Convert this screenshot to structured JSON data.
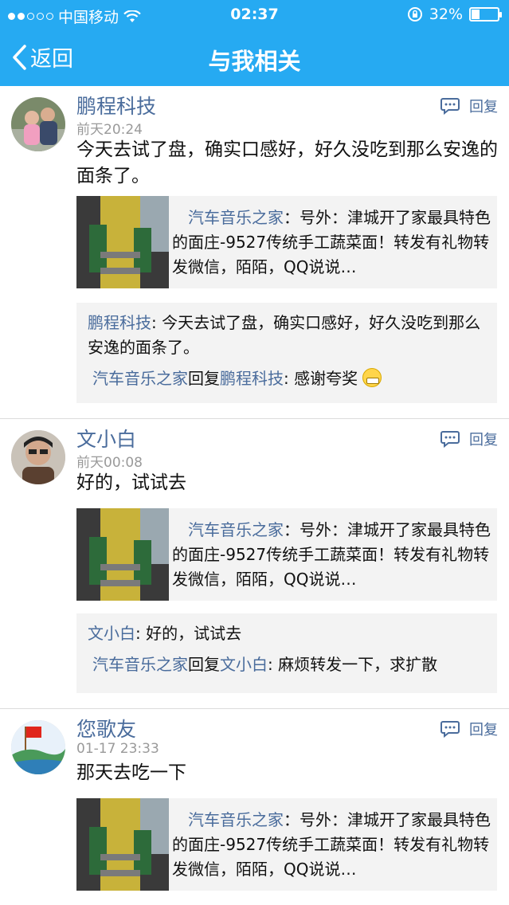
{
  "status_bar": {
    "carrier": "中国移动",
    "time": "02:37",
    "battery_percent": "32%",
    "battery_level": 0.32,
    "signal_bars_filled": 2
  },
  "nav": {
    "back_label": "返回",
    "title": "与我相关"
  },
  "reply_label": "回复",
  "share": {
    "source": "汽车音乐之家",
    "text": "号外：津城开了家最具特色的面庄-9527传统手工蔬菜面！转发有礼物转发微信，陌陌，QQ说说…"
  },
  "items": [
    {
      "user": "鹏程科技",
      "time": "前天20:24",
      "content": "今天去试了盘，确实口感好，好久没吃到那么安逸的面条了。",
      "comment_user": "鹏程科技",
      "comment_text": ": 今天去试了盘，确实口感好，好久没吃到那么安逸的面条了。",
      "reply_from": "汽车音乐之家",
      "reply_word": "回复",
      "reply_to": "鹏程科技",
      "reply_text": ": 感谢夸奖",
      "reply_has_emoji": true
    },
    {
      "user": "文小白",
      "time": "前天00:08",
      "content": "好的，试试去",
      "comment_user": "文小白",
      "comment_text": ": 好的，试试去",
      "reply_from": "汽车音乐之家",
      "reply_word": "回复",
      "reply_to": "文小白",
      "reply_text": ": 麻烦转发一下，求扩散",
      "reply_has_emoji": false
    },
    {
      "user": "您歌友",
      "time": "01-17 23:33",
      "content": "那天去吃一下"
    }
  ],
  "colors": {
    "nav_bg": "#26aaf2",
    "link": "#4a6c9c",
    "card_bg": "#f3f3f3"
  }
}
